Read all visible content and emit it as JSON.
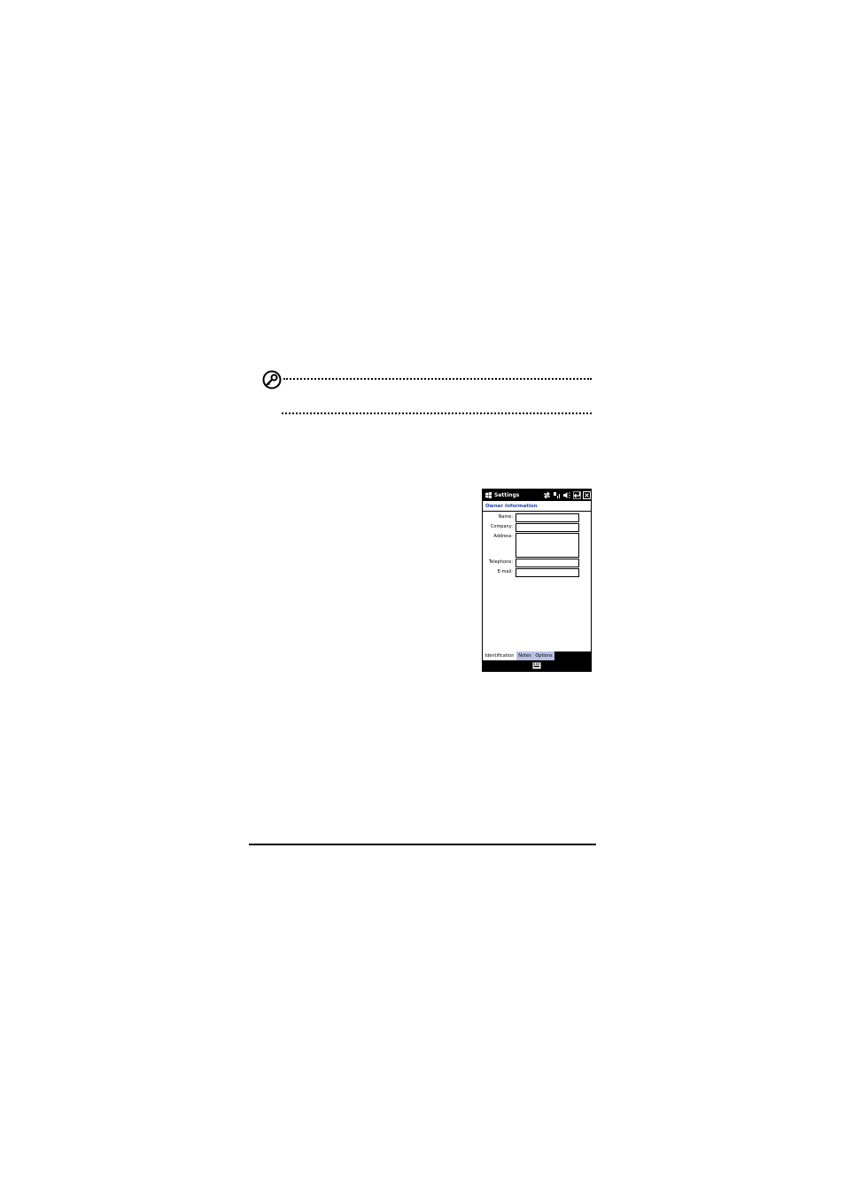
{
  "device": {
    "status_title": "Settings",
    "section_title": "Owner Information",
    "fields": [
      {
        "label": "Name:",
        "value": ""
      },
      {
        "label": "Company:",
        "value": ""
      },
      {
        "label": "Address:",
        "value": ""
      },
      {
        "label": "Telephone:",
        "value": ""
      },
      {
        "label": "E-mail:",
        "value": ""
      }
    ],
    "tabs": [
      {
        "label": "Identification",
        "active": true
      },
      {
        "label": "Notes",
        "active": false
      },
      {
        "label": "Options",
        "active": false
      }
    ],
    "icons": {
      "start": "windows-flag-icon",
      "connectivity": "connectivity-arrows-icon",
      "signal": "signal-icon",
      "volume": "speaker-icon",
      "ok": "ok-enter-icon",
      "close": "close-box-icon",
      "keyboard": "keyboard-icon",
      "note": "key-note-icon"
    },
    "colors": {
      "section_title": "#1f3fb0",
      "tab_inactive": "#b9c2e6",
      "bar": "#000000"
    }
  }
}
